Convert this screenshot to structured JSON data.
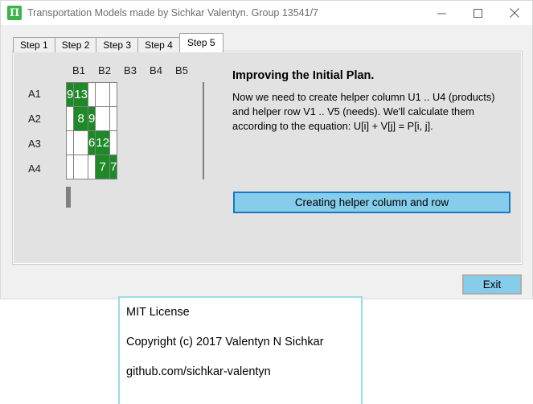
{
  "window": {
    "title": "Transportation Models made by Sichkar Valentyn. Group 13541/7",
    "icon": "app-pi-icon",
    "icon_glyph": "Π",
    "controls": {
      "minimize": "minimize-icon",
      "maximize": "maximize-icon",
      "close": "close-icon"
    }
  },
  "tabs": [
    {
      "label": "Step 1",
      "active": false
    },
    {
      "label": "Step 2",
      "active": false
    },
    {
      "label": "Step 3",
      "active": false
    },
    {
      "label": "Step 4",
      "active": false
    },
    {
      "label": "Step 5",
      "active": true
    }
  ],
  "matrix": {
    "column_headers": [
      "B1",
      "B2",
      "B3",
      "B4",
      "B5"
    ],
    "row_labels": [
      "A1",
      "A2",
      "A3",
      "A4"
    ],
    "cells": [
      [
        "9",
        "13",
        "",
        "",
        ""
      ],
      [
        "",
        "8",
        "9",
        "",
        ""
      ],
      [
        "",
        "",
        "6",
        "12",
        ""
      ],
      [
        "",
        "",
        "",
        "7",
        "7"
      ]
    ],
    "helper_column_cells": [
      "",
      "",
      "",
      ""
    ],
    "helper_row_cells": [
      "",
      "",
      "",
      "",
      ""
    ],
    "colors": {
      "filled": "#1e8a27",
      "empty": "#ffffff",
      "helper": "#ffff00",
      "border": "#808080"
    }
  },
  "info": {
    "heading": "Improving the Initial Plan.",
    "body": "Now we need to create helper column U1 .. U4 (products) and helper row V1 .. V5 (needs). We'll calculate them according to the equation: U[i] + V[j] = P[i, j]."
  },
  "action_button": {
    "label": "Creating helper column and row",
    "fill": "#85cdea",
    "border": "#1b76c8"
  },
  "exit_button": {
    "label": "Exit",
    "fill": "#85cdea",
    "border": "#adadad"
  },
  "license": {
    "border_color": "#9bdbe8",
    "lines": [
      "MIT License",
      "Copyright (c) 2017 Valentyn N Sichkar",
      "github.com/sichkar-valentyn"
    ]
  }
}
